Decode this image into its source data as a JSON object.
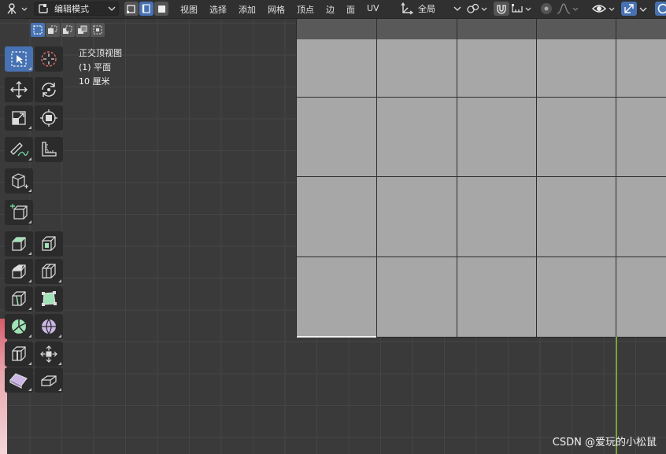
{
  "header": {
    "mode": {
      "label": "编辑模式",
      "icon": "edit-mode-icon"
    },
    "menus": [
      "视图",
      "选择",
      "添加",
      "网格",
      "顶点",
      "边",
      "面",
      "UV"
    ],
    "orientation": {
      "label": "全局",
      "icon": "transform-orientation-icon"
    },
    "active_select_mode": "edge"
  },
  "overlay": {
    "view_name": "正交顶视图",
    "object_name": "(1) 平面",
    "scale": "10 厘米"
  },
  "toolbar": {
    "tools": [
      "select-box",
      "cursor",
      "move",
      "rotate",
      "scale",
      "transform",
      "annotate",
      "measure",
      "add-cube",
      "add-cube-wire",
      "extrude-region",
      "inset-faces",
      "bevel",
      "loop-cut",
      "knife",
      "poly-build",
      "spin",
      "smooth",
      "edge-slide",
      "shrink-fatten",
      "shear",
      "rip-region"
    ],
    "active_tool": "select-box"
  },
  "colors": {
    "active": "#4772b3",
    "background": "#393939",
    "header": "#303030",
    "mesh": "#a7a7a7",
    "y_axis": "#7aa33b"
  },
  "watermark": "CSDN @爱玩的小松鼠"
}
